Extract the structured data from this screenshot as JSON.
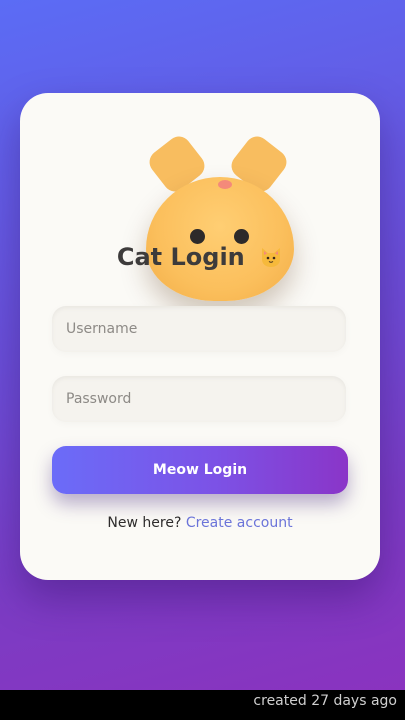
{
  "login": {
    "title": "Cat Login",
    "title_emoji_icon": "cat-face-icon",
    "username_placeholder": "Username",
    "password_placeholder": "Password",
    "button_label": "Meow Login",
    "signup_prompt": "New here?",
    "signup_link": "Create account"
  },
  "footer": {
    "text": "created 27 days ago"
  },
  "colors": {
    "background_start": "#5b6cf5",
    "background_end": "#8a33bf",
    "card": "#fbfaf6",
    "mascot": "#fbbf5c",
    "link": "#6b74d9"
  }
}
